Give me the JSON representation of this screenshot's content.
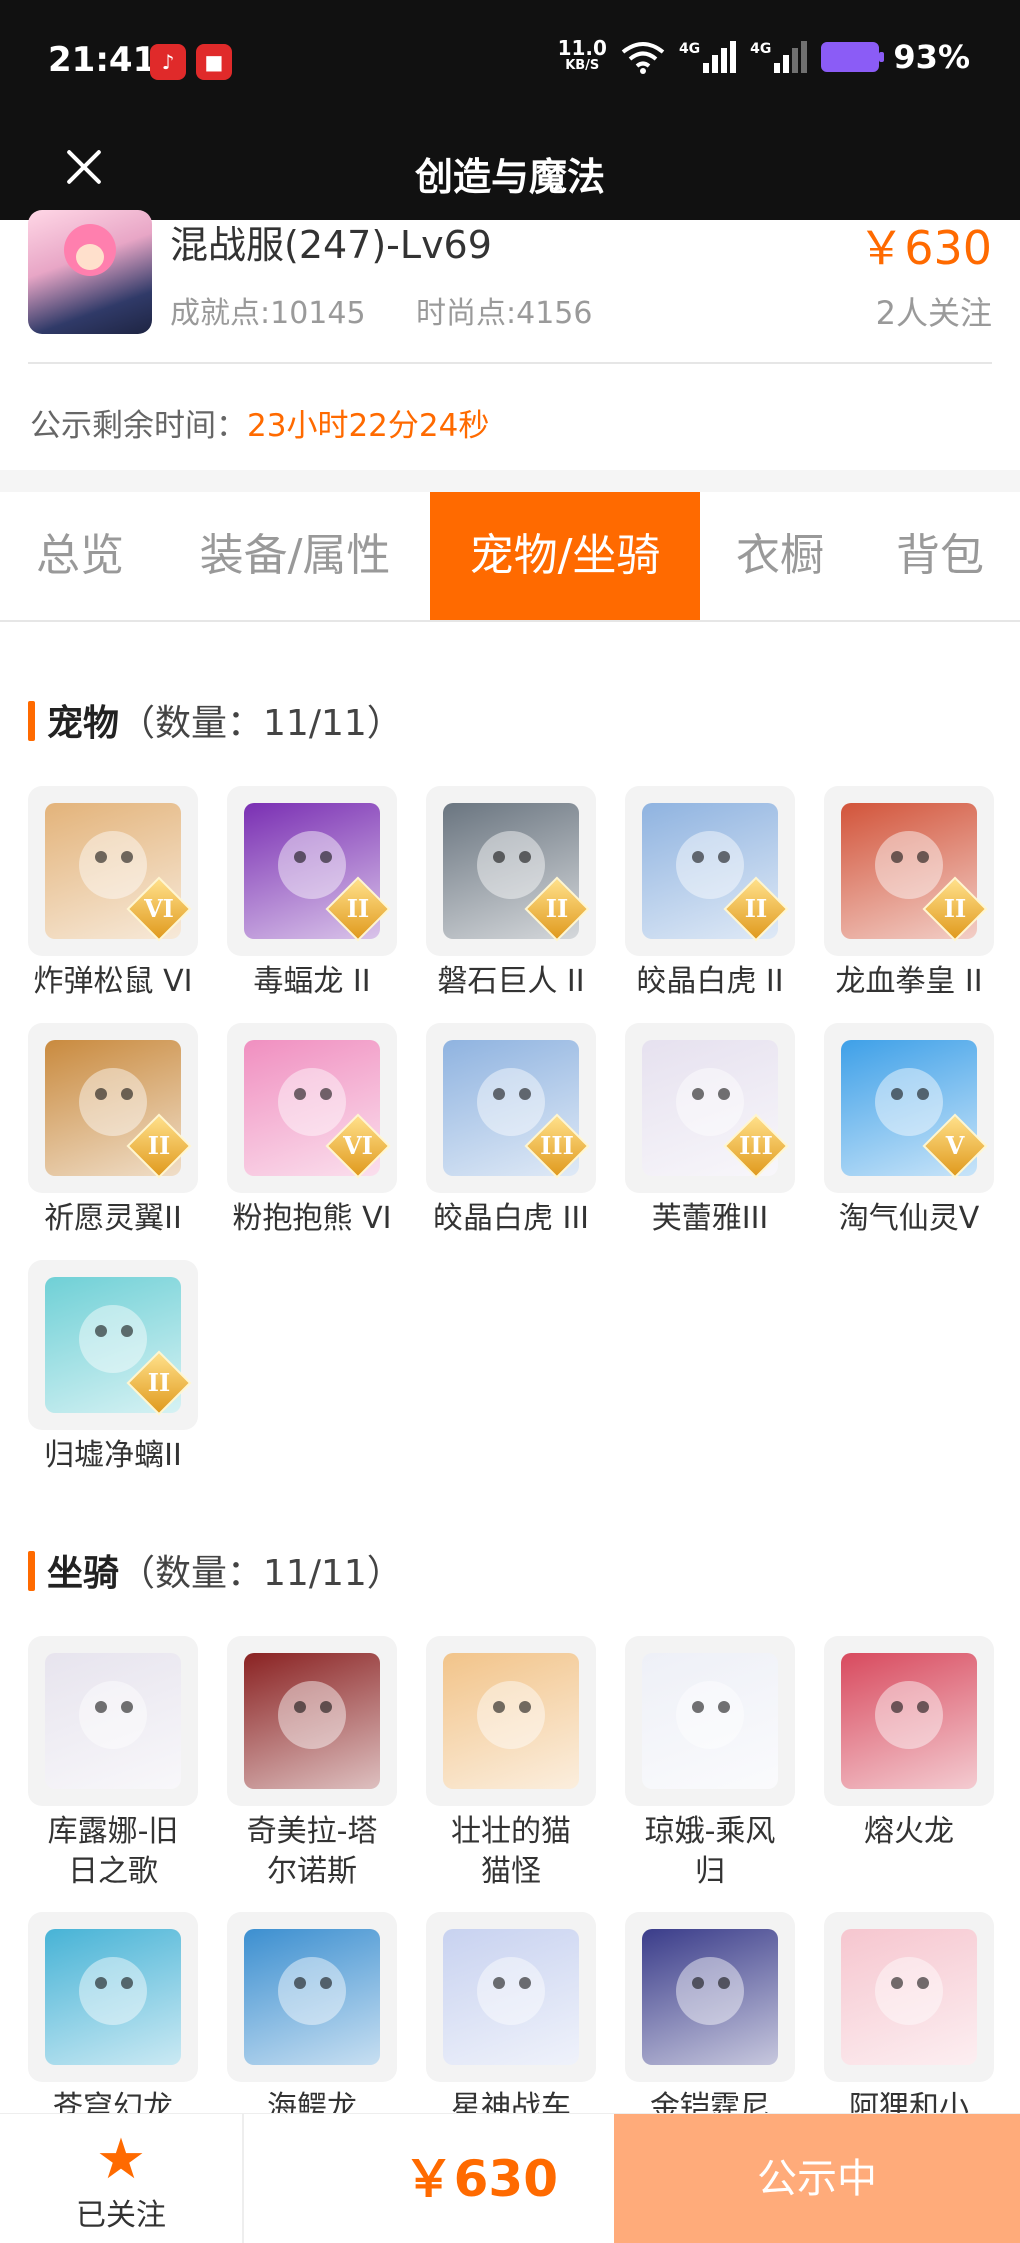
{
  "status_bar": {
    "time": "21:41",
    "app_icon_1": "music-icon",
    "app_icon_2": "news-app-icon",
    "speed_value": "11.0",
    "speed_unit": "KB/S",
    "network_1": "4G",
    "network_2": "4G",
    "battery": "93%"
  },
  "header": {
    "title": "创造与魔法"
  },
  "listing": {
    "server": "混战服(247)-Lv69",
    "price": "￥630",
    "achievement": "成就点:10145",
    "fashion": "时尚点:4156",
    "followers": "2人关注",
    "countdown_label": "公示剩余时间：",
    "countdown_value": "23小时22分24秒"
  },
  "tabs": [
    {
      "label": "总览"
    },
    {
      "label": "装备/属性"
    },
    {
      "label": "宠物/坐骑",
      "active": true
    },
    {
      "label": "衣橱"
    },
    {
      "label": "背包"
    }
  ],
  "pets": {
    "title": "宠物",
    "count": "（数量：11/11）",
    "items": [
      {
        "name": "炸弹松鼠 VI",
        "badge": "VI",
        "color": "#e3b37a"
      },
      {
        "name": "毒蝠龙 II",
        "badge": "II",
        "color": "#7a2fb3"
      },
      {
        "name": "磐石巨人 II",
        "badge": "II",
        "color": "#6a7580"
      },
      {
        "name": "皎晶白虎 II",
        "badge": "II",
        "color": "#8fb3e0"
      },
      {
        "name": "龙血拳皇 II",
        "badge": "II",
        "color": "#d2543a"
      },
      {
        "name": "祈愿灵翼II",
        "badge": "II",
        "color": "#c98a3e"
      },
      {
        "name": "粉抱抱熊 VI",
        "badge": "VI",
        "color": "#f08fc0"
      },
      {
        "name": "皎晶白虎 III",
        "badge": "III",
        "color": "#8fb3e0"
      },
      {
        "name": "芙蕾雅III",
        "badge": "III",
        "color": "#e6e1ef"
      },
      {
        "name": "淘气仙灵V",
        "badge": "V",
        "color": "#3ea0e8"
      },
      {
        "name": "归墟净螭II",
        "badge": "II",
        "color": "#6fd0d6"
      }
    ]
  },
  "mounts": {
    "title": "坐骑",
    "count": "（数量：11/11）",
    "items": [
      {
        "name": "库露娜-旧日之歌",
        "color": "#e7e4ee"
      },
      {
        "name": "奇美拉-塔尔诺斯",
        "color": "#8a2222"
      },
      {
        "name": "壮壮的猫猫怪",
        "color": "#f2c48a"
      },
      {
        "name": "琼娥-乘风归",
        "color": "#eef0f7"
      },
      {
        "name": "熔火龙",
        "color": "#d84a5e"
      },
      {
        "name": "苍穹幻龙",
        "color": "#47b3d6"
      },
      {
        "name": "海鳄龙",
        "color": "#3c8fd0"
      },
      {
        "name": "星神战车",
        "color": "#c8d2f0"
      },
      {
        "name": "金铠霆尼",
        "color": "#3a3c8a"
      },
      {
        "name": "阿狸和小小",
        "color": "#f6c6cf"
      }
    ]
  },
  "bottom": {
    "fav_label": "已关注",
    "price": "￥630",
    "status": "公示中"
  },
  "colors": {
    "accent": "#ff6a00",
    "status_button": "#ffab7a"
  }
}
